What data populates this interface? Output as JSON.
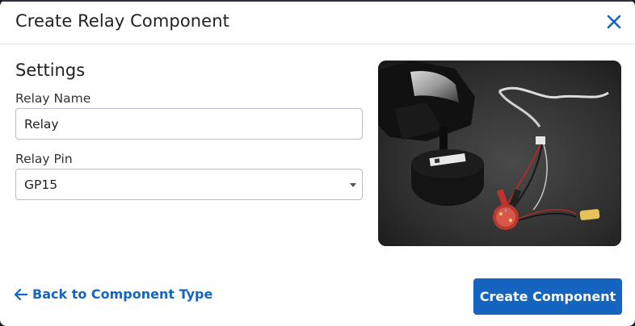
{
  "dialog": {
    "title": "Create Relay Component",
    "close_icon": "close-icon"
  },
  "settings": {
    "heading": "Settings",
    "name_field": {
      "label": "Relay Name",
      "value": "Relay"
    },
    "pin_field": {
      "label": "Relay Pin",
      "selected": "GP15"
    }
  },
  "preview": {
    "image": "relay-lamp-photo"
  },
  "footer": {
    "back_label": "Back to Component Type",
    "back_icon": "arrow-left-icon",
    "create_label": "Create Component"
  },
  "colors": {
    "accent": "#1565c0",
    "title_text": "#222222",
    "border": "#b9bec7"
  }
}
